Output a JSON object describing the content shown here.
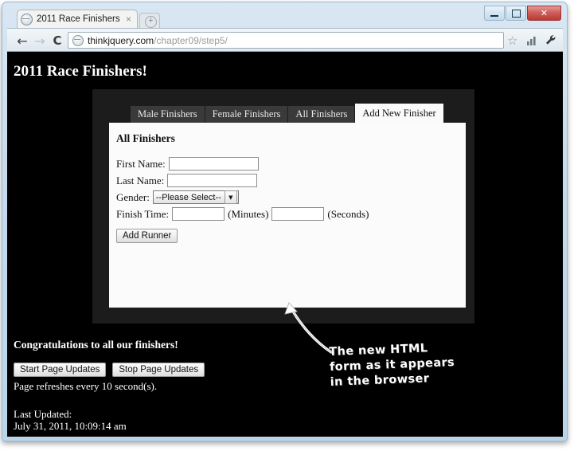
{
  "window": {
    "minimize_label": "Minimize",
    "maximize_label": "Maximize",
    "close_label": "✕"
  },
  "browser": {
    "tab": {
      "title": "2011 Race Finishers",
      "close_label": "×",
      "favicon": "globe-icon"
    },
    "new_tab_label": "+",
    "nav": {
      "back": "←",
      "forward": "→",
      "reload": "C"
    },
    "address_bar": {
      "host": "thinkjquery.com",
      "path": "/chapter09/step5/",
      "full_url": "thinkjquery.com/chapter09/step5/",
      "favicon": "globe-icon"
    },
    "bookmark_star": "☆",
    "stats_icon": "stats-icon",
    "wrench_icon": "wrench-icon"
  },
  "page": {
    "heading": "2011 Race Finishers!",
    "tabs": [
      {
        "label": "Male Finishers",
        "active": false
      },
      {
        "label": "Female Finishers",
        "active": false
      },
      {
        "label": "All Finishers",
        "active": false
      },
      {
        "label": "Add New Finisher",
        "active": true
      }
    ],
    "panel_heading": "All Finishers",
    "form": {
      "first_name": {
        "label": "First Name:",
        "value": "",
        "placeholder": ""
      },
      "last_name": {
        "label": "Last Name:",
        "value": "",
        "placeholder": ""
      },
      "gender": {
        "label": "Gender:",
        "selected": "--Please Select--",
        "arrow": "▼",
        "options": [
          "--Please Select--"
        ]
      },
      "finish_time": {
        "label": "Finish Time:",
        "minutes_value": "",
        "minutes_unit": "(Minutes)",
        "seconds_value": "",
        "seconds_unit": "(Seconds)"
      },
      "submit_label": "Add Runner"
    },
    "footer": {
      "congrats": "Congratulations to all our finishers!",
      "start_button": "Start Page Updates",
      "stop_button": "Stop Page Updates",
      "refresh_note": "Page refreshes every 10 second(s).",
      "last_updated_label": "Last Updated:",
      "last_updated_value": "July 31, 2011, 10:09:14 am"
    }
  },
  "annotation": {
    "line1": "The new HTML",
    "line2": "form as it appears",
    "line3": "in the browser"
  },
  "colors": {
    "page_background": "#000000",
    "panel_background": "#1c1c1c",
    "tab_inactive": "#3a3a3a",
    "tab_active": "#fafafa",
    "content_background": "#fbfbfb",
    "text_light": "#ffffff",
    "frame_aero": "#c6dbec"
  }
}
